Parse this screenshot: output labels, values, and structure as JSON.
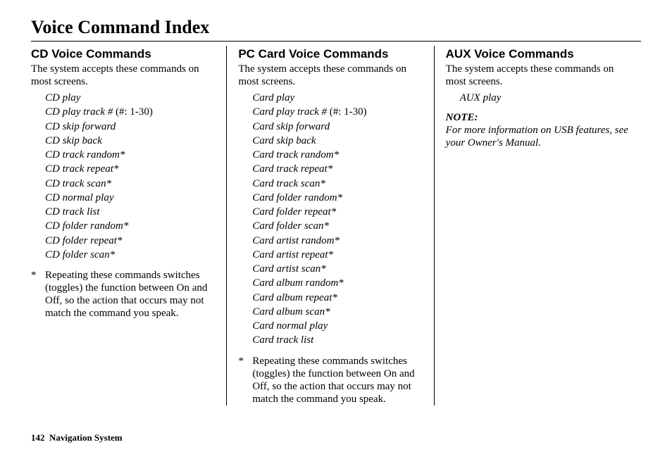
{
  "page_title": "Voice Command Index",
  "footer": {
    "page_number": "142",
    "label": "Navigation System"
  },
  "col1": {
    "heading": "CD Voice Commands",
    "intro": "The system accepts these commands on most screens.",
    "commands": [
      {
        "text": "CD play"
      },
      {
        "text": "CD play track #",
        "suffix": " (#: 1-30)"
      },
      {
        "text": "CD skip forward"
      },
      {
        "text": "CD skip back"
      },
      {
        "text": "CD track random*"
      },
      {
        "text": "CD track repeat*"
      },
      {
        "text": "CD track scan*"
      },
      {
        "text": "CD normal play"
      },
      {
        "text": "CD track list"
      },
      {
        "text": "CD folder random*"
      },
      {
        "text": "CD folder repeat*"
      },
      {
        "text": "CD folder scan*"
      }
    ],
    "footnote_marker": "*",
    "footnote": "Repeating these commands switches (toggles) the function between On and Off, so the action that occurs may not match the command you speak."
  },
  "col2": {
    "heading": "PC Card Voice Commands",
    "intro": "The system accepts these commands on most screens.",
    "commands": [
      {
        "text": "Card play"
      },
      {
        "text": "Card play track #",
        "suffix": " (#: 1-30)"
      },
      {
        "text": "Card skip forward"
      },
      {
        "text": "Card skip back"
      },
      {
        "text": "Card track random*"
      },
      {
        "text": "Card track repeat*"
      },
      {
        "text": "Card track scan*"
      },
      {
        "text": "Card folder random*"
      },
      {
        "text": "Card folder repeat*"
      },
      {
        "text": "Card folder scan*"
      },
      {
        "text": "Card artist random*"
      },
      {
        "text": "Card artist repeat*"
      },
      {
        "text": "Card artist scan*"
      },
      {
        "text": "Card album random*"
      },
      {
        "text": "Card album repeat*"
      },
      {
        "text": "Card album scan*"
      },
      {
        "text": "Card normal play"
      },
      {
        "text": "Card track list"
      }
    ],
    "footnote_marker": "*",
    "footnote": "Repeating these commands switches (toggles) the function between On and Off, so the action that occurs may not match the command you speak."
  },
  "col3": {
    "heading": "AUX Voice Commands",
    "intro": "The system accepts these commands on most screens.",
    "commands": [
      {
        "text": "AUX play"
      }
    ],
    "note_heading": "NOTE:",
    "note_body": "For more information on USB features, see your Owner's Manual."
  }
}
